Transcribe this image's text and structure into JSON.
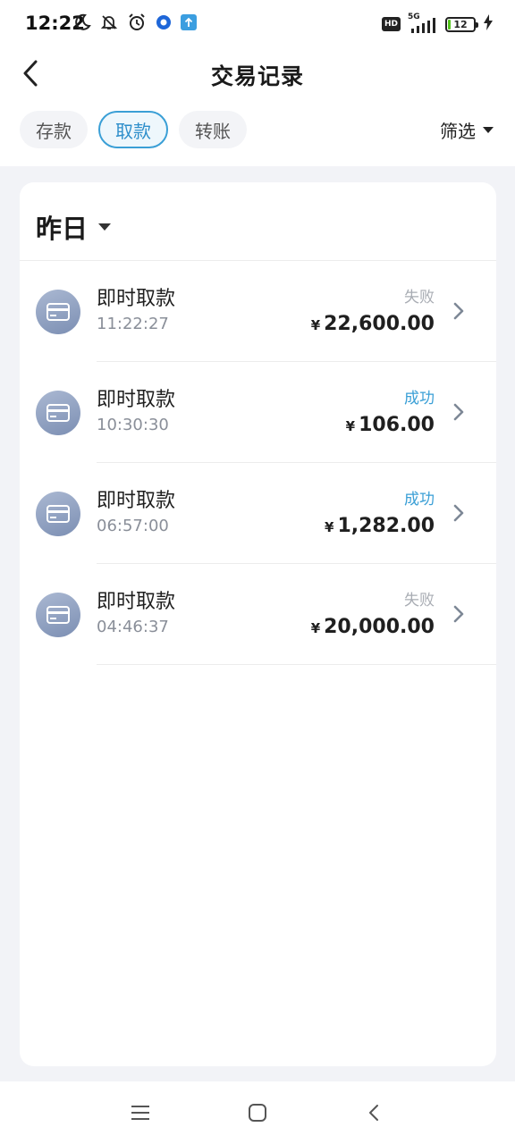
{
  "status_bar": {
    "time": "12:22",
    "network": "5G",
    "hd": "HD",
    "battery": "12"
  },
  "header": {
    "title": "交易记录"
  },
  "tabs": [
    {
      "label": "存款",
      "active": false
    },
    {
      "label": "取款",
      "active": true
    },
    {
      "label": "转账",
      "active": false
    }
  ],
  "filter": {
    "label": "筛选"
  },
  "section": {
    "date_label": "昨日"
  },
  "currency_symbol": "¥",
  "transactions": [
    {
      "title": "即时取款",
      "time": "11:22:27",
      "status": "失败",
      "amount": "22,600.00"
    },
    {
      "title": "即时取款",
      "time": "10:30:30",
      "status": "成功",
      "amount": "106.00"
    },
    {
      "title": "即时取款",
      "time": "06:57:00",
      "status": "成功",
      "amount": "1,282.00"
    },
    {
      "title": "即时取款",
      "time": "04:46:37",
      "status": "失败",
      "amount": "20,000.00"
    }
  ],
  "colors": {
    "accent": "#3a9fd6",
    "failed": "#a8acb3",
    "background": "#f2f3f7"
  }
}
